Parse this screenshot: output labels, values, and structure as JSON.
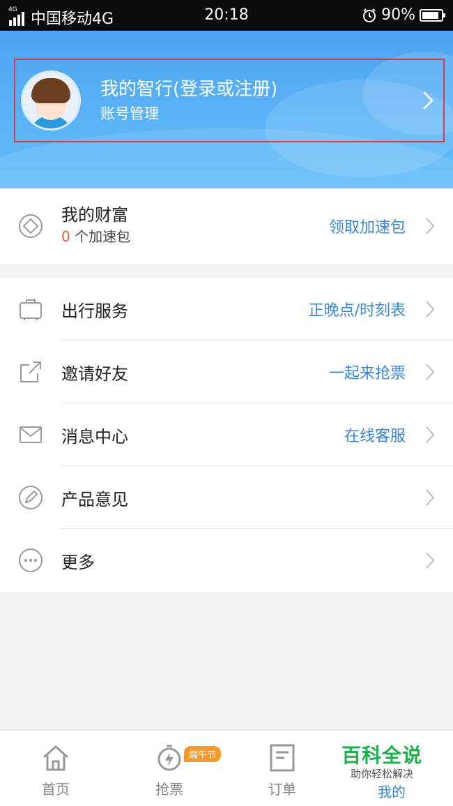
{
  "status_bar": {
    "network": "4G",
    "carrier": "中国移动4G",
    "time": "20:18",
    "battery": "90%",
    "battery_level": 0.9,
    "icons": [
      "signal-icon",
      "alarm-icon",
      "battery-icon"
    ]
  },
  "profile": {
    "title": "我的智行(登录或注册)",
    "subtitle": "账号管理"
  },
  "wealth": {
    "title": "我的财富",
    "count": "0",
    "count_suffix": " 个加速包",
    "action": "领取加速包",
    "icon": "diamond-icon"
  },
  "menu": {
    "items": [
      {
        "label": "出行服务",
        "extra": "正晚点/时刻表",
        "icon": "luggage-icon"
      },
      {
        "label": "邀请好友",
        "extra": "一起来抢票",
        "icon": "share-icon"
      },
      {
        "label": "消息中心",
        "extra": "在线客服",
        "icon": "mail-icon"
      },
      {
        "label": "产品意见",
        "extra": "",
        "icon": "pen-icon"
      },
      {
        "label": "更多",
        "extra": "",
        "icon": "more-icon"
      }
    ]
  },
  "tabbar": {
    "tabs": [
      {
        "label": "首页",
        "icon": "home-icon"
      },
      {
        "label": "抢票",
        "icon": "stopwatch-icon",
        "badge": "端午节"
      },
      {
        "label": "订单",
        "icon": "order-icon"
      },
      {
        "label": "我的",
        "icon": "user-icon"
      }
    ],
    "active_color": "#3a86d4"
  },
  "watermark": {
    "title": "百科全说",
    "subtitle": "助你轻松解决"
  },
  "colors": {
    "header": "#5ab3f6",
    "accent": "#3a86d4",
    "highlight_border": "#d93a4a",
    "count": "#f05a3c",
    "badge": "#f39a2c"
  }
}
